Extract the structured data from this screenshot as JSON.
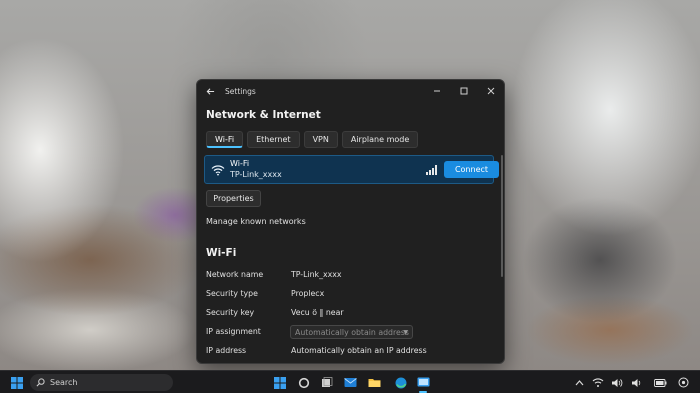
{
  "window": {
    "app_title": "Settings",
    "page_title": "Network & Internet"
  },
  "tabs": [
    {
      "label": "Wi-Fi",
      "active": true
    },
    {
      "label": "Ethernet",
      "active": false
    },
    {
      "label": "VPN",
      "active": false
    },
    {
      "label": "Airplane mode",
      "active": false
    }
  ],
  "network_card": {
    "type_label": "Wi-Fi",
    "ssid": "TP-Link_xxxx",
    "connect_label": "Connect",
    "icon": "wifi-icon",
    "signal_icon": "signal-bars-icon"
  },
  "actions": {
    "properties_label": "Properties",
    "manage_label": "Manage known networks"
  },
  "details": {
    "section_title": "Wi-Fi",
    "rows": [
      {
        "key": "Network name",
        "value": "TP-Link_xxxx"
      },
      {
        "key": "Security type",
        "value": "Proplecx"
      },
      {
        "key": "Security key",
        "value": "Vecu ö ‖ near"
      },
      {
        "key": "IP assignment",
        "value": "Automatically obtain address"
      },
      {
        "key": "IP address",
        "value": "Automatically obtain an IP address"
      }
    ]
  },
  "taskbar": {
    "search_placeholder": "Search"
  },
  "colors": {
    "accent": "#1a8ce0",
    "tab_underline": "#4cc2ff",
    "card_bg": "#0f3350",
    "window_bg": "#202020"
  }
}
